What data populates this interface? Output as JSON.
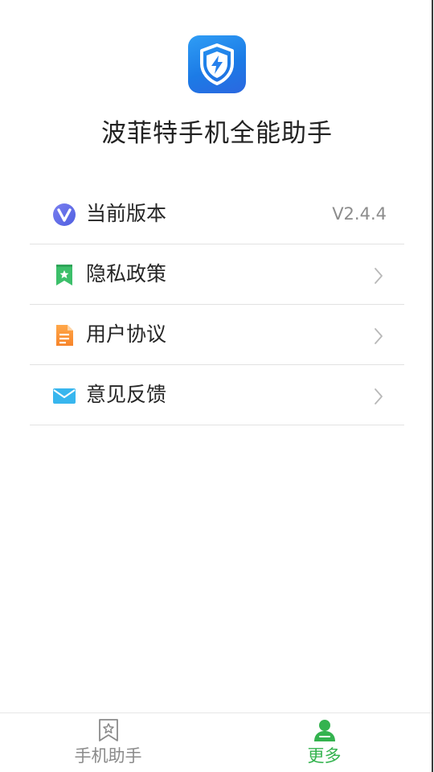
{
  "header": {
    "app_name": "波菲特手机全能助手",
    "logo_icon": "shield-lightning-icon",
    "logo_color": "#2a8af0"
  },
  "menu": {
    "items": [
      {
        "label": "当前版本",
        "value": "V2.4.4",
        "icon": "version-v-icon"
      },
      {
        "label": "隐私政策",
        "icon": "bookmark-star-icon"
      },
      {
        "label": "用户协议",
        "icon": "document-icon"
      },
      {
        "label": "意见反馈",
        "icon": "envelope-icon"
      }
    ]
  },
  "bottom_nav": {
    "tabs": [
      {
        "label": "手机助手",
        "icon": "bookmark-star-outline-icon",
        "active": false
      },
      {
        "label": "更多",
        "icon": "user-icon",
        "active": true
      }
    ],
    "active_color": "#34b34f",
    "inactive_color": "#8a8a8a"
  }
}
